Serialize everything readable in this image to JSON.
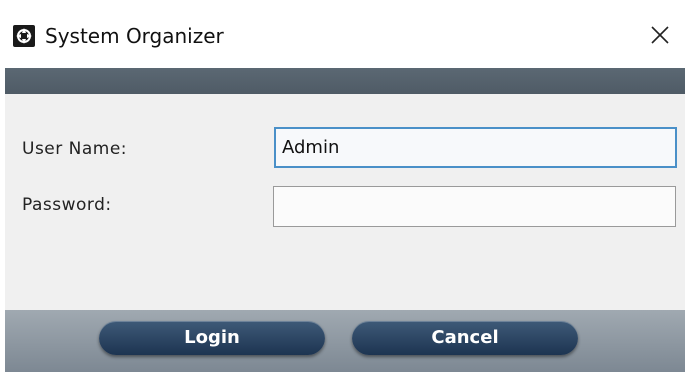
{
  "window": {
    "title": "System Organizer",
    "icon": "system-organizer-app-icon",
    "close_icon": "close-icon"
  },
  "form": {
    "username_label": "User Name:",
    "username_value": "Admin",
    "password_label": "Password:",
    "password_value": ""
  },
  "buttons": {
    "login_label": "Login",
    "cancel_label": "Cancel"
  },
  "colors": {
    "header_band": "#55616c",
    "content_bg": "#f0f0f0",
    "footer_band": "#8c959e",
    "button_bg": "#2a4462",
    "input_focus_border": "#4a90c8"
  }
}
